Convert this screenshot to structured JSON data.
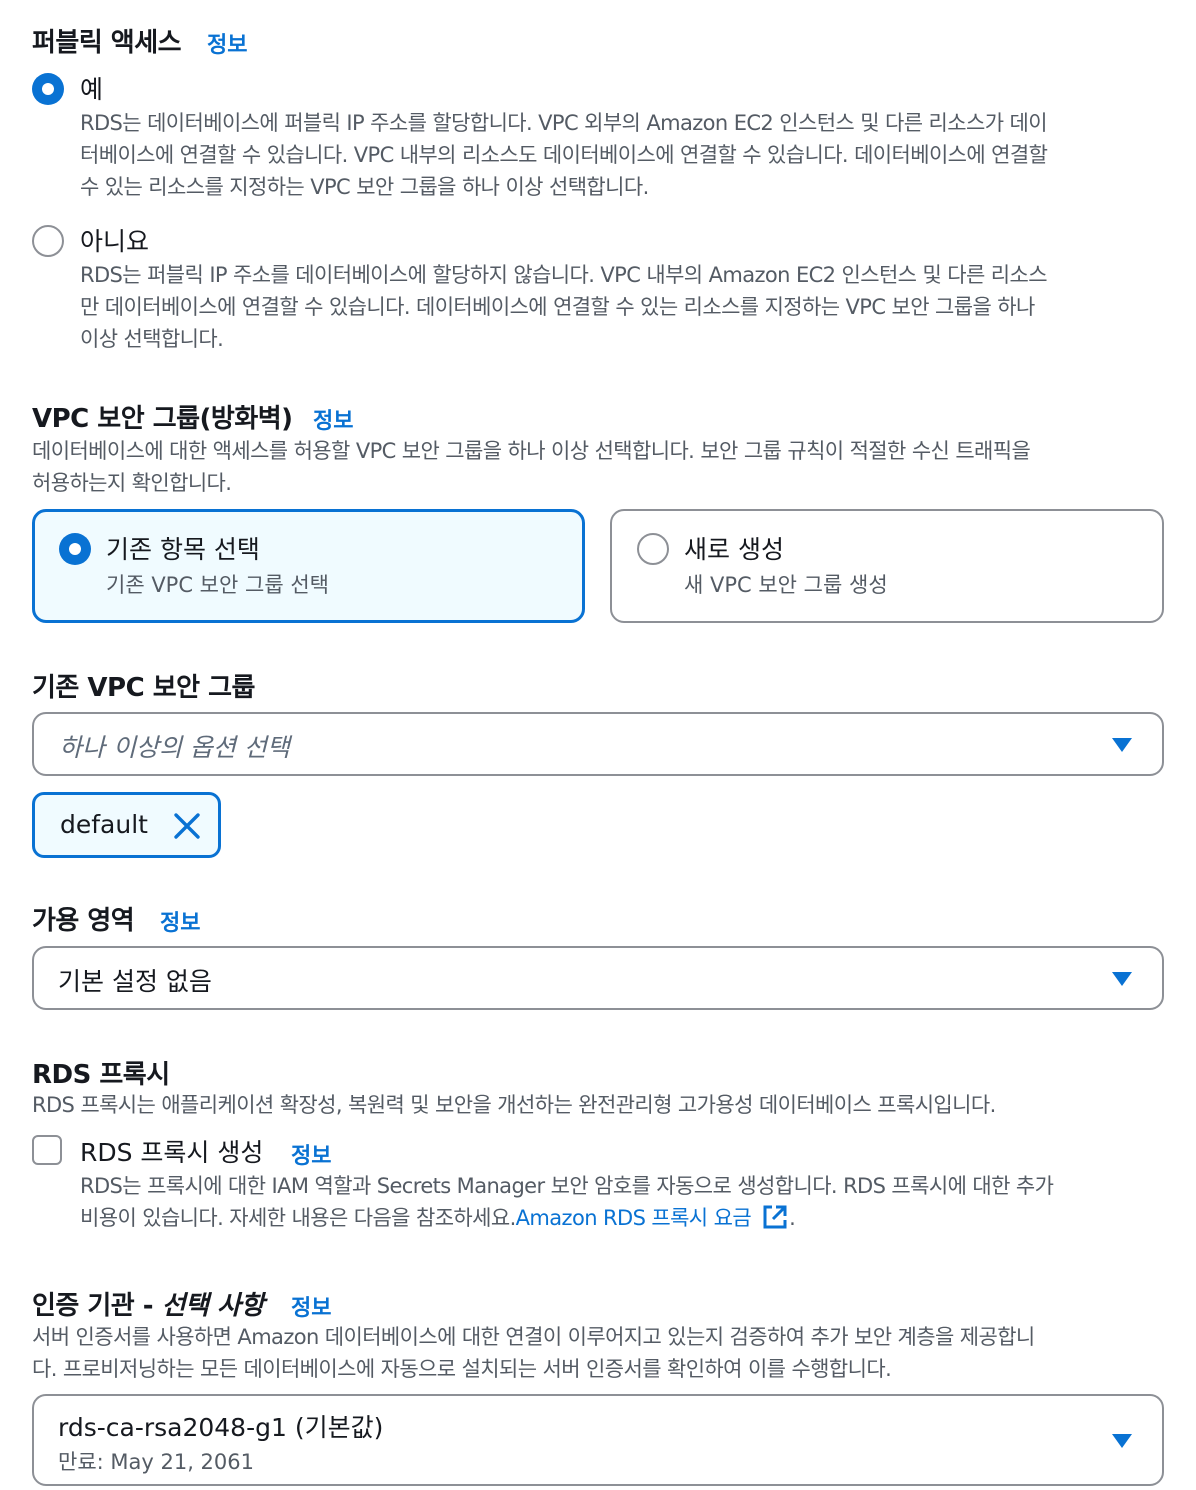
{
  "public_access": {
    "title": "퍼블릭 액세스",
    "info": "정보",
    "options": [
      {
        "label": "예",
        "selected": true,
        "desc_lines": [
          "RDS는 데이터베이스에 퍼블릭 IP 주소를 할당합니다. VPC 외부의 Amazon EC2 인스턴스 및 다른 리소스가 데이",
          "터베이스에 연결할 수 있습니다. VPC 내부의 리소스도 데이터베이스에 연결할 수 있습니다. 데이터베이스에 연결할",
          "수 있는 리소스를 지정하는 VPC 보안 그룹을 하나 이상 선택합니다."
        ]
      },
      {
        "label": "아니요",
        "selected": false,
        "desc_lines": [
          "RDS는 퍼블릭 IP 주소를 데이터베이스에 할당하지 않습니다. VPC 내부의 Amazon EC2 인스턴스 및 다른 리소스",
          "만 데이터베이스에 연결할 수 있습니다. 데이터베이스에 연결할 수 있는 리소스를 지정하는 VPC 보안 그룹을 하나",
          "이상 선택합니다."
        ]
      }
    ]
  },
  "vpc_sg": {
    "title": "VPC 보안 그룹(방화벽)",
    "info": "정보",
    "desc_lines": [
      "데이터베이스에 대한 액세스를 허용할 VPC 보안 그룹을 하나 이상 선택합니다. 보안 그룹 규칙이 적절한 수신 트래픽을",
      "허용하는지 확인합니다."
    ],
    "tiles": [
      {
        "title": "기존 항목 선택",
        "sub": "기존 VPC 보안 그룹 선택",
        "selected": true
      },
      {
        "title": "새로 생성",
        "sub": "새 VPC 보안 그룹 생성",
        "selected": false
      }
    ]
  },
  "existing_sg": {
    "title": "기존 VPC 보안 그룹",
    "placeholder": "하나 이상의 옵션 선택",
    "tokens": [
      "default"
    ]
  },
  "az": {
    "title": "가용 영역",
    "info": "정보",
    "value": "기본 설정 없음"
  },
  "rds_proxy": {
    "title": "RDS 프록시",
    "desc": "RDS 프록시는 애플리케이션 확장성, 복원력 및 보안을 개선하는 완전관리형 고가용성 데이터베이스 프록시입니다.",
    "checkbox_label": "RDS 프록시 생성",
    "info": "정보",
    "checked": false,
    "cb_desc_line1": "RDS는 프록시에 대한 IAM 역할과 Secrets Manager 보안 암호를 자동으로 생성합니다. RDS 프록시에 대한 추가",
    "cb_desc_line2": "비용이 있습니다. 자세한 내용은 다음을 참조하세요.",
    "link_text": "Amazon RDS 프록시 요금",
    "trail": "."
  },
  "ca": {
    "title_main": "인증 기관 - ",
    "title_italic": "선택 사항",
    "info": "정보",
    "desc_lines": [
      "서버 인증서를 사용하면 Amazon 데이터베이스에 대한 연결이 이루어지고 있는지 검증하여 추가 보안 계층을 제공합니",
      "다. 프로비저닝하는 모든 데이터베이스에 자동으로 설치되는 서버 인증서를 확인하여 이를 수행합니다."
    ],
    "value": "rds-ca-rsa2048-g1 (기본값)",
    "sub": "만료: May 21, 2061"
  },
  "colors": {
    "accent": "#0972d3",
    "text": "#16191f",
    "muted": "#545b64",
    "border": "#8d9096",
    "selected_bg": "#f0fbff"
  },
  "icons": [
    "radio-selected-icon",
    "radio-unselected-icon",
    "caret-down-icon",
    "close-icon",
    "checkbox-icon",
    "external-link-icon"
  ]
}
